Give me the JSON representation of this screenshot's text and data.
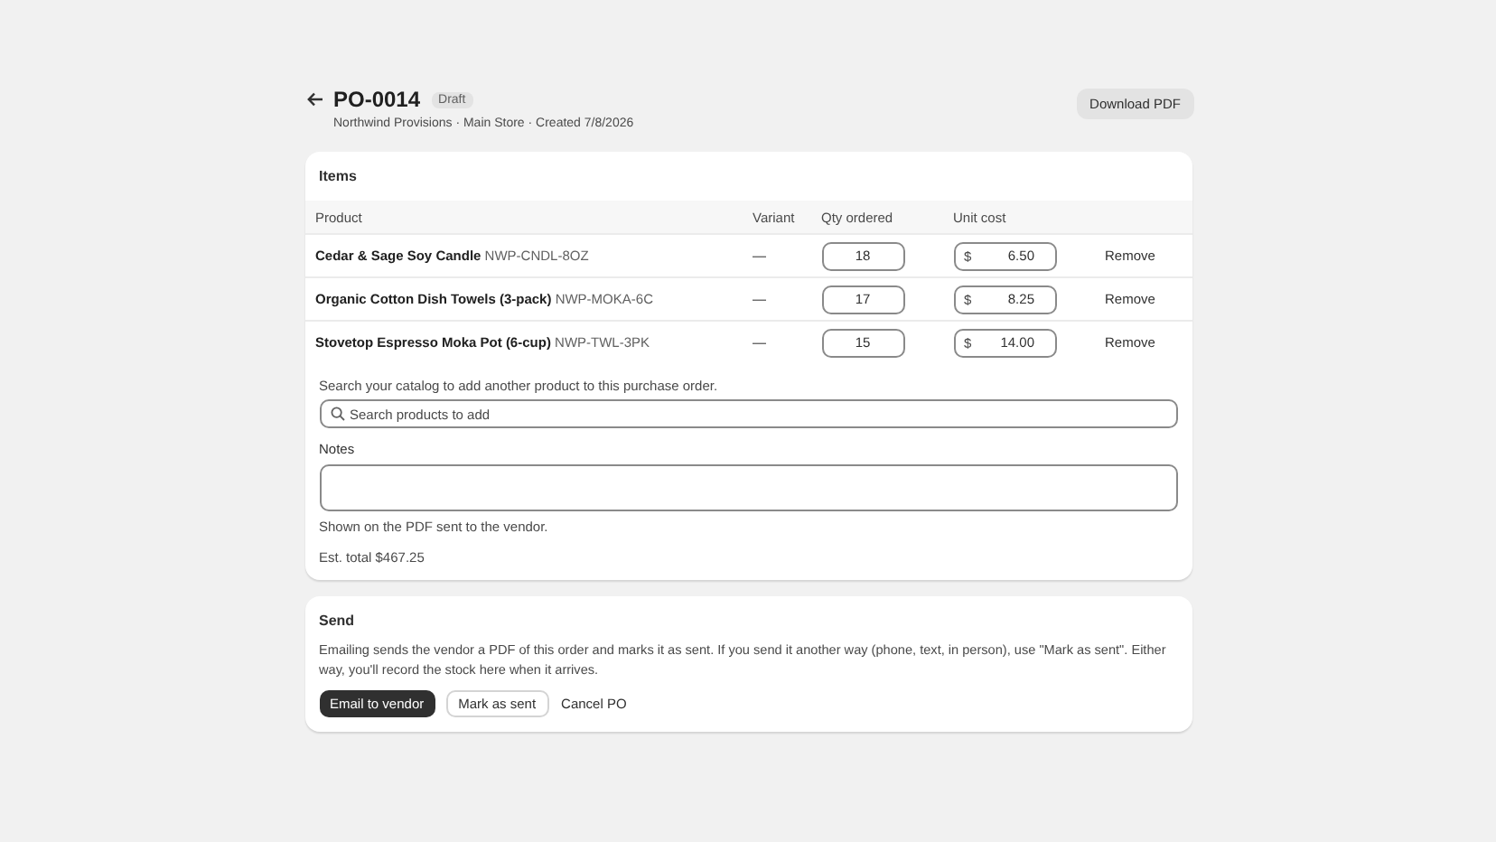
{
  "header": {
    "title": "PO-0014",
    "badge": "Draft",
    "subtitle": "Northwind Provisions · Main Store · Created 7/8/2026",
    "action": "Download PDF"
  },
  "items": {
    "title": "Items",
    "columns": [
      "Product",
      "Variant",
      "Qty ordered",
      "Unit cost"
    ],
    "rows": [
      {
        "product": "Cedar & Sage Soy Candle",
        "sku": "NWP-CNDL-8OZ",
        "variant": "—",
        "qty": "18",
        "currency": "$",
        "cost": "6.50",
        "action": "Remove"
      },
      {
        "product": "Organic Cotton Dish Towels (3-pack)",
        "sku": "NWP-MOKA-6C",
        "variant": "—",
        "qty": "17",
        "currency": "$",
        "cost": "8.25",
        "action": "Remove"
      },
      {
        "product": "Stovetop Espresso Moka Pot (6-cup)",
        "sku": "NWP-TWL-3PK",
        "variant": "—",
        "qty": "15",
        "currency": "$",
        "cost": "14.00",
        "action": "Remove"
      }
    ],
    "search_hint": "Search your catalog to add another product to this purchase order.",
    "search": {
      "placeholder": "Search products to add"
    },
    "notes_label": "Notes",
    "notes_help": "Shown on the PDF sent to the vendor.",
    "total": "Est. total $467.25"
  },
  "send": {
    "title": "Send",
    "text": "Emailing sends the vendor a PDF of this order and marks it as sent. If you send it another way (phone, text, in person), use \"Mark as sent\". Either way, you'll record the stock here when it arrives.",
    "buttons": [
      {
        "label": "Email to vendor",
        "kind": "primary"
      },
      {
        "label": "Mark as sent",
        "kind": "secondary"
      },
      {
        "label": "Cancel PO",
        "kind": "plain"
      }
    ]
  }
}
